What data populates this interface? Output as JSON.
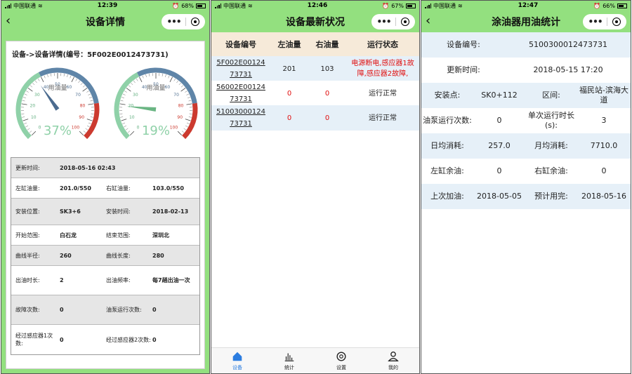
{
  "status_bars": [
    {
      "carrier": "中国联通",
      "time": "12:39",
      "battery": "68%"
    },
    {
      "carrier": "中国联通",
      "time": "12:46",
      "battery": "67%"
    },
    {
      "carrier": "中国联通",
      "time": "12:47",
      "battery": "66%"
    }
  ],
  "panel1": {
    "title": "设备详情",
    "back_icon": "‹",
    "breadcrumb": "设备->设备详情(编号：5F002E0012473731)",
    "gauges": [
      {
        "label": "用油量",
        "percent_text": "37%",
        "value_fraction": 0.37
      },
      {
        "label": "用油量",
        "percent_text": "19%",
        "value_fraction": 0.19
      }
    ],
    "gauge_ticks": [
      "0",
      "10",
      "20",
      "30",
      "40",
      "50",
      "60",
      "70",
      "80",
      "90",
      "100"
    ],
    "rows": [
      {
        "k1": "更新时间:",
        "v1": "2018-05-16 02:43",
        "k2": "",
        "v2": ""
      },
      {
        "k1": "左缸油量:",
        "v1": "201.0/550",
        "k2": "右缸油量:",
        "v2": "103.0/550"
      },
      {
        "k1": "安装位置:",
        "v1": "SK3+6",
        "k2": "安装时间:",
        "v2": "2018-02-13"
      },
      {
        "k1": "开始范围:",
        "v1": "白石龙",
        "k2": "结束范围:",
        "v2": "深圳北"
      },
      {
        "k1": "曲线半径:",
        "v1": "260",
        "k2": "曲线长度:",
        "v2": "280"
      },
      {
        "k1": "出油时长:",
        "v1": "2",
        "k2": "出油频率:",
        "v2": "每7趟出油一次"
      },
      {
        "k1": "故障次数:",
        "v1": "0",
        "k2": "油泵运行次数:",
        "v2": "0"
      },
      {
        "k1": "经过感应器1次数:",
        "v1": "0",
        "k2": "经过感应器2次数:",
        "v2": "0"
      }
    ]
  },
  "panel2": {
    "title": "设备最新状况",
    "headers": [
      "设备编号",
      "左油量",
      "右油量",
      "运行状态"
    ],
    "rows": [
      {
        "id_line1": "5F002E00124",
        "id_line2": "73731",
        "left": "201",
        "right": "103",
        "status": "电源断电,感应器1故障,感应器2故障,",
        "alert": true
      },
      {
        "id_line1": "56002E00124",
        "id_line2": "73731",
        "left": "0",
        "right": "0",
        "status": "运行正常",
        "alert": false
      },
      {
        "id_line1": "51003000124",
        "id_line2": "73731",
        "left": "0",
        "right": "0",
        "status": "运行正常",
        "alert": false
      }
    ],
    "tabs": [
      {
        "label": "设备",
        "icon": "home-icon",
        "active": true
      },
      {
        "label": "统计",
        "icon": "bar-chart-icon",
        "active": false
      },
      {
        "label": "设置",
        "icon": "gear-icon",
        "active": false
      },
      {
        "label": "我的",
        "icon": "user-icon",
        "active": false
      }
    ],
    "colors": {
      "active_tab": "#2b7de0",
      "alert_text": "#e01010"
    }
  },
  "panel3": {
    "title": "涂油器用油统计",
    "device_id_label": "设备编号:",
    "device_id": "5100300012473731",
    "update_label": "更新时间:",
    "update_value": "2018-05-15 17:20",
    "install_label": "安装点:",
    "install_value": "SK0+112",
    "section_label": "区间:",
    "section_value": "福民站-滨海大道",
    "pump_label": "油泵运行次数:",
    "pump_value": "0",
    "single_label": "单次运行时长(s):",
    "single_value": "3",
    "daily_label": "日均消耗:",
    "daily_value": "257.0",
    "monthly_label": "月均消耗:",
    "monthly_value": "7710.0",
    "left_label": "左缸余油:",
    "left_value": "0",
    "right_label": "右缸余油:",
    "right_value": "0",
    "last_label": "上次加油:",
    "last_value": "2018-05-05",
    "expect_label": "预计用完:",
    "expect_value": "2018-05-16"
  },
  "theme": {
    "header_green": "#93e07f",
    "row_blue": "#e6f0f8",
    "table_head": "#f6ead9"
  }
}
